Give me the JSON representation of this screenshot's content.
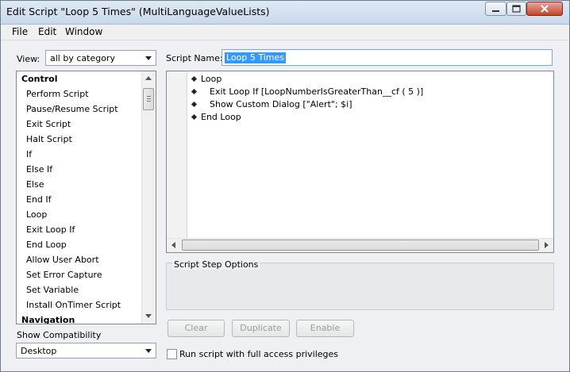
{
  "window": {
    "title": "Edit Script \"Loop 5 Times\" (MultiLanguageValueLists)"
  },
  "titlebar_icons": {
    "minimize": "minimize-icon",
    "maximize": "maximize-icon",
    "close": "close-icon"
  },
  "menu": {
    "file": "File",
    "edit": "Edit",
    "window": "Window"
  },
  "left_panel": {
    "view_label": "View:",
    "view_value": "all by category",
    "list": [
      {
        "type": "header",
        "label": "Control"
      },
      {
        "type": "item",
        "label": "Perform Script"
      },
      {
        "type": "item",
        "label": "Pause/Resume Script"
      },
      {
        "type": "item",
        "label": "Exit Script"
      },
      {
        "type": "item",
        "label": "Halt Script"
      },
      {
        "type": "item",
        "label": "If"
      },
      {
        "type": "item",
        "label": "Else If"
      },
      {
        "type": "item",
        "label": "Else"
      },
      {
        "type": "item",
        "label": "End If"
      },
      {
        "type": "item",
        "label": "Loop"
      },
      {
        "type": "item",
        "label": "Exit Loop If"
      },
      {
        "type": "item",
        "label": "End Loop"
      },
      {
        "type": "item",
        "label": "Allow User Abort"
      },
      {
        "type": "item",
        "label": "Set Error Capture"
      },
      {
        "type": "item",
        "label": "Set Variable"
      },
      {
        "type": "item",
        "label": "Install OnTimer Script"
      },
      {
        "type": "header",
        "label": "Navigation"
      }
    ],
    "show_compat_label": "Show Compatibility",
    "compat_value": "Desktop"
  },
  "script_name": {
    "label": "Script Name:",
    "value": "Loop 5 Times"
  },
  "steps": [
    {
      "text": "Loop"
    },
    {
      "text": "Exit Loop If [LoopNumberIsGreaterThan__cf ( 5 )]"
    },
    {
      "text": "Show Custom Dialog [\"Alert\"; $i]"
    },
    {
      "text": "End Loop"
    }
  ],
  "options": {
    "title": "Script Step Options"
  },
  "buttons": {
    "clear": "Clear",
    "duplicate": "Duplicate",
    "enable": "Enable"
  },
  "run_full_access": {
    "label": "Run script with full access privileges",
    "checked": false
  }
}
